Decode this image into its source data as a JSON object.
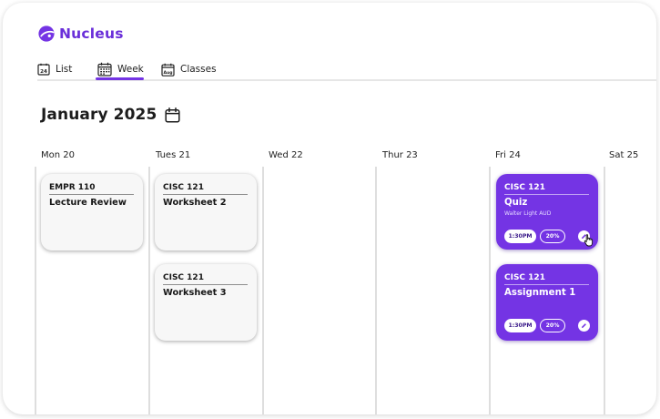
{
  "app": {
    "name": "Nucleus",
    "logo_icon": "nucleus-logo-icon",
    "accent_color": "#7434e4"
  },
  "tabs": [
    {
      "label": "List",
      "icon": "list-calendar-icon",
      "icon_text": "24"
    },
    {
      "label": "Week",
      "icon": "week-calendar-icon",
      "selected": true
    },
    {
      "label": "Classes",
      "icon": "classes-calendar-icon",
      "icon_text": "Aug"
    }
  ],
  "header": {
    "month_title": "January 2025",
    "month_picker_icon": "calendar-icon"
  },
  "days": [
    "Mon 20",
    "Tues 21",
    "Wed 22",
    "Thur 23",
    "Fri 24",
    "Sat 25"
  ],
  "cards": [
    {
      "day": "Mon 20",
      "code": "EMPR 110",
      "title": "Lecture Review",
      "style": "plain"
    },
    {
      "day": "Tues 21",
      "code": "CISC 121",
      "title": "Worksheet 2",
      "style": "plain"
    },
    {
      "day": "Tues 21",
      "code": "CISC 121",
      "title": "Worksheet 3",
      "style": "plain"
    },
    {
      "day": "Fri 24",
      "code": "CISC 121",
      "title": "Quiz",
      "subtitle": "Walter Light AUD",
      "time": "1:30PM",
      "weight": "20%",
      "style": "accent"
    },
    {
      "day": "Fri 24",
      "code": "CISC 121",
      "title": "Assignment 1",
      "time": "1:30PM",
      "weight": "20%",
      "style": "accent"
    }
  ]
}
